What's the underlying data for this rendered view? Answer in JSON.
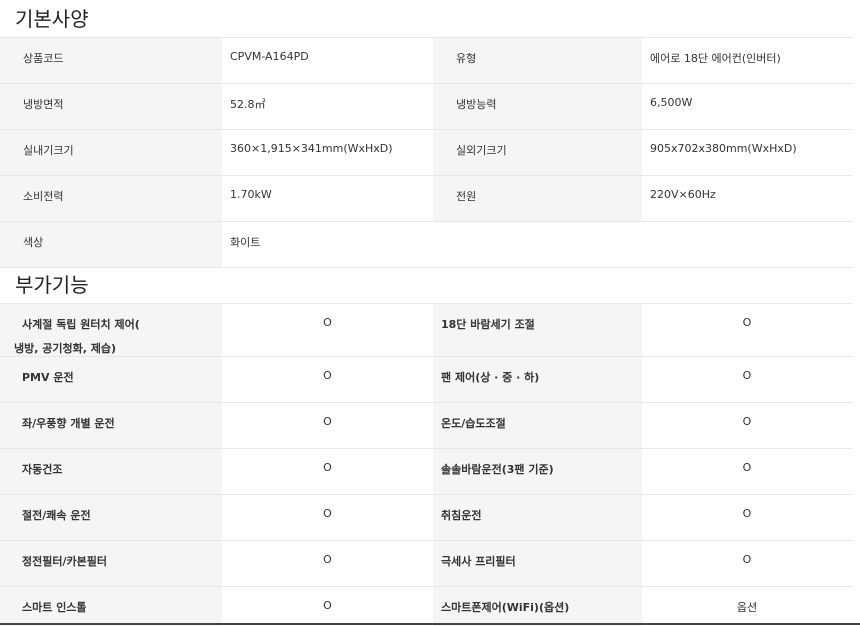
{
  "sections": {
    "basic_title": "기본사양",
    "extra_title": "부가기능"
  },
  "specs": [
    {
      "label1": "상품코드",
      "value1": "CPVM-A164PD",
      "label2": "유형",
      "value2": "에어로 18단 에어컨(인버터)"
    },
    {
      "label1": "냉방면적",
      "value1": "52.8㎡",
      "label2": "냉방능력",
      "value2": "6,500W"
    },
    {
      "label1": "실내기크기",
      "value1": "360×1,915×341mm(WxHxD)",
      "label2": "실외기크기",
      "value2": "905x702x380mm(WxHxD)"
    },
    {
      "label1": "소비전력",
      "value1": "1.70kW",
      "label2": "전원",
      "value2": "220V×60Hz"
    },
    {
      "label1": "색상",
      "value1": "화이트"
    }
  ],
  "features": [
    {
      "label1": "사계절 독립 원터치 제어(",
      "label1_cont": "냉방, 공기청화, 제습)",
      "mark1": "O",
      "label2": "18단 바람세기 조절",
      "mark2": "O"
    },
    {
      "label1": "PMV 운전",
      "mark1": "O",
      "label2": "팬 제어(상 · 중 · 하)",
      "mark2": "O"
    },
    {
      "label1": "좌/우풍향 개별 운전",
      "mark1": "O",
      "label2": "온도/습도조절",
      "mark2": "O"
    },
    {
      "label1": "자동건조",
      "mark1": "O",
      "label2": "솔솔바람운전(3팬 기준)",
      "mark2": "O"
    },
    {
      "label1": "절전/쾌속 운전",
      "mark1": "O",
      "label2": "취침운전",
      "mark2": "O"
    },
    {
      "label1": "정전필터/카본필터",
      "mark1": "O",
      "label2": "극세사 프리필터",
      "mark2": "O"
    },
    {
      "label1": "스마트 인스톨",
      "mark1": "O",
      "label2": "스마트폰제어(WiFi)(옵션)",
      "mark2": "옵션"
    }
  ]
}
